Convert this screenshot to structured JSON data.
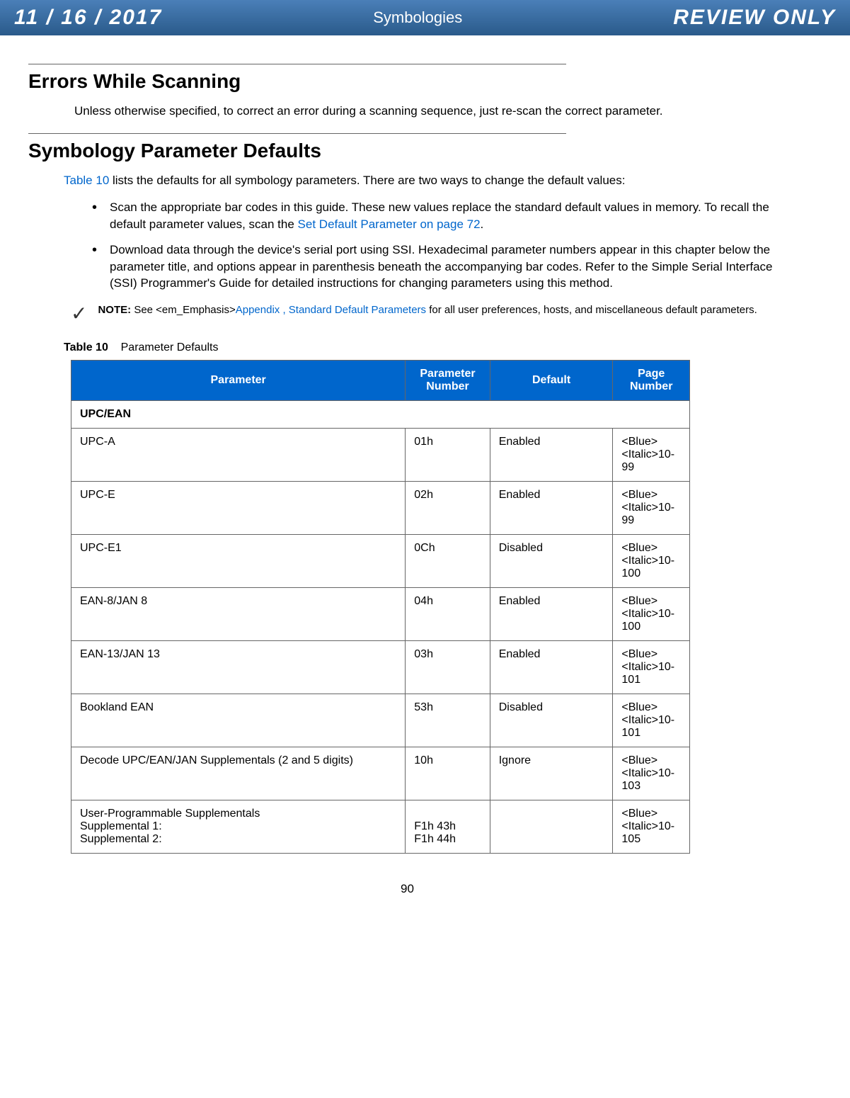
{
  "header": {
    "date": "11 / 16 / 2017",
    "title": "Symbologies",
    "review": "REVIEW ONLY"
  },
  "section1": {
    "title": "Errors While Scanning",
    "body": "Unless otherwise specified, to correct an error during a scanning sequence, just re-scan the correct parameter."
  },
  "section2": {
    "title": "Symbology Parameter Defaults",
    "intro_pre": "Table 10",
    "intro_post": " lists the defaults for all symbology parameters. There are two ways to change the default values:",
    "bullet1_pre": "Scan the appropriate bar codes in this guide. These new values replace the standard default values in memory. To recall the default parameter values, scan the ",
    "bullet1_link": "Set Default Parameter on page 72",
    "bullet1_post": ".",
    "bullet2": "Download data through the device's serial port using SSI. Hexadecimal parameter numbers appear in this chapter below the parameter title, and options appear in parenthesis beneath the accompanying bar codes. Refer to the Simple Serial Interface (SSI) Programmer's Guide for detailed instructions for changing parameters using this method."
  },
  "note": {
    "label": "NOTE:",
    "pre": "See <em_Emphasis>",
    "link": "Appendix , Standard Default Parameters",
    "post": " for all user preferences, hosts, and miscellaneous default parameters."
  },
  "table": {
    "caption_label": "Table 10",
    "caption_text": "Parameter Defaults",
    "headers": {
      "param": "Parameter",
      "num": "Parameter Number",
      "def": "Default",
      "page": "Page Number"
    },
    "section_label": "UPC/EAN",
    "rows": [
      {
        "param": "UPC-A",
        "num": "01h",
        "def": "Enabled",
        "page": "<Blue><Italic>10-99"
      },
      {
        "param": "UPC-E",
        "num": "02h",
        "def": "Enabled",
        "page": "<Blue><Italic>10-99"
      },
      {
        "param": "UPC-E1",
        "num": "0Ch",
        "def": "Disabled",
        "page": "<Blue><Italic>10-100"
      },
      {
        "param": "EAN-8/JAN 8",
        "num": "04h",
        "def": "Enabled",
        "page": "<Blue><Italic>10-100"
      },
      {
        "param": "EAN-13/JAN 13",
        "num": "03h",
        "def": "Enabled",
        "page": "<Blue><Italic>10-101"
      },
      {
        "param": "Bookland EAN",
        "num": "53h",
        "def": "Disabled",
        "page": "<Blue><Italic>10-101"
      },
      {
        "param": "Decode UPC/EAN/JAN Supplementals (2 and 5 digits)",
        "num": "10h",
        "def": "Ignore",
        "page": "<Blue><Italic>10-103"
      }
    ],
    "multi_row": {
      "line1": "User-Programmable Supplementals",
      "line2": "Supplemental 1:",
      "line3": "Supplemental 2:",
      "num2": "F1h 43h",
      "num3": "F1h 44h",
      "page": "<Blue><Italic>10-105"
    }
  },
  "page_number": "90"
}
